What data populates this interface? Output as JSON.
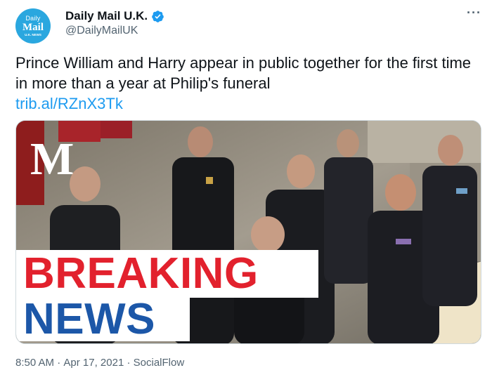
{
  "author": {
    "display_name": "Daily Mail U.K.",
    "handle": "@DailyMailUK",
    "avatar": {
      "line1": "Daily",
      "line2": "Mail",
      "line3": "U.K. NEWS"
    },
    "verified_icon": "verified-badge-icon"
  },
  "tweet": {
    "text": "Prince William and Harry appear in public together for the first time in more than a year at Philip's funeral",
    "link": "trib.al/RZnX3Tk"
  },
  "media": {
    "logo": "M",
    "banner_line1": "BREAKING",
    "banner_line2": "NEWS"
  },
  "meta": {
    "time": "8:50 AM",
    "sep1": " · ",
    "date": "Apr 17, 2021",
    "sep2": " · ",
    "source": "SocialFlow"
  },
  "colors": {
    "link": "#1d9bf0",
    "avatar_bg": "#2aa7df",
    "breaking_red": "#e2212d",
    "news_blue": "#1c57a8"
  },
  "icons": {
    "more": "more-options-icon"
  }
}
